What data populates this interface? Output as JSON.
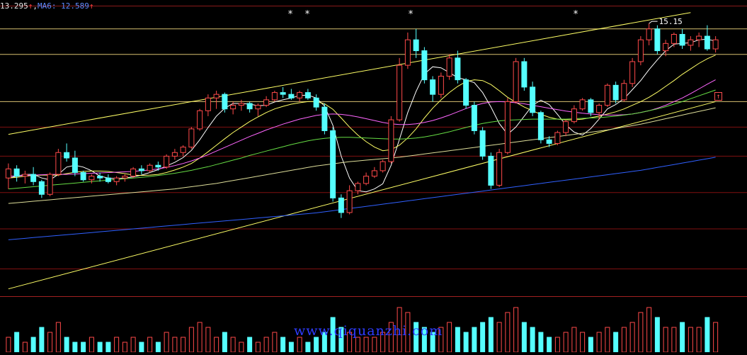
{
  "header": {
    "price_value": "13.295",
    "arrow_up": "↑",
    "separator": ",",
    "ma_label": "MA6: 12.589"
  },
  "annotations": {
    "peak_label": "15.15",
    "markers": [
      "*",
      "*",
      "*",
      "*"
    ],
    "buy_signal": "↑"
  },
  "watermark": "www.qiquanzhi.com",
  "colors": {
    "up": "#ff4a4a",
    "down": "#55ffff",
    "ma_short": "#ffffff",
    "ma_mid": "#ffff66",
    "ma_purple": "#ff66ff",
    "ma_green": "#66dd44",
    "ma_long": "#3060ff",
    "trend": "#ffff66",
    "grid": "#801010"
  },
  "chart_data": {
    "type": "candlestick",
    "title": "",
    "xlabel": "",
    "ylabel": "",
    "ylim": [
      8.0,
      15.6
    ],
    "max_label": 15.15,
    "ohlc": [
      [
        10.9,
        11.3,
        10.6,
        11.15
      ],
      [
        11.15,
        11.25,
        10.8,
        10.95
      ],
      [
        10.95,
        11.1,
        10.75,
        11.0
      ],
      [
        11.0,
        11.2,
        10.7,
        10.8
      ],
      [
        10.8,
        10.85,
        10.35,
        10.45
      ],
      [
        10.45,
        11.05,
        10.4,
        11.0
      ],
      [
        11.0,
        11.7,
        10.95,
        11.6
      ],
      [
        11.6,
        11.85,
        11.35,
        11.45
      ],
      [
        11.45,
        11.65,
        10.95,
        11.05
      ],
      [
        11.05,
        11.1,
        10.8,
        10.85
      ],
      [
        10.85,
        11.0,
        10.75,
        10.95
      ],
      [
        10.95,
        11.05,
        10.8,
        10.9
      ],
      [
        10.9,
        11.0,
        10.75,
        10.8
      ],
      [
        10.8,
        10.95,
        10.7,
        10.9
      ],
      [
        10.9,
        11.0,
        10.8,
        10.95
      ],
      [
        10.95,
        11.2,
        10.9,
        11.15
      ],
      [
        11.15,
        11.25,
        11.0,
        11.1
      ],
      [
        11.1,
        11.3,
        11.05,
        11.25
      ],
      [
        11.25,
        11.35,
        11.1,
        11.2
      ],
      [
        11.2,
        11.55,
        11.15,
        11.5
      ],
      [
        11.5,
        11.7,
        11.4,
        11.6
      ],
      [
        11.6,
        11.8,
        11.5,
        11.75
      ],
      [
        11.75,
        12.3,
        11.7,
        12.25
      ],
      [
        12.25,
        12.8,
        12.2,
        12.75
      ],
      [
        12.75,
        13.2,
        12.6,
        13.1
      ],
      [
        13.1,
        13.3,
        12.8,
        13.2
      ],
      [
        13.2,
        13.25,
        12.7,
        12.8
      ],
      [
        12.8,
        13.0,
        12.65,
        12.9
      ],
      [
        12.9,
        13.05,
        12.75,
        12.95
      ],
      [
        12.95,
        13.0,
        12.7,
        12.8
      ],
      [
        12.8,
        12.95,
        12.6,
        12.9
      ],
      [
        12.9,
        13.15,
        12.85,
        13.05
      ],
      [
        13.05,
        13.3,
        13.0,
        13.25
      ],
      [
        13.25,
        13.4,
        13.1,
        13.2
      ],
      [
        13.2,
        13.35,
        13.05,
        13.1
      ],
      [
        13.1,
        13.3,
        13.0,
        13.25
      ],
      [
        13.25,
        13.35,
        13.05,
        13.1
      ],
      [
        13.1,
        13.2,
        12.75,
        12.85
      ],
      [
        12.85,
        12.95,
        12.1,
        12.2
      ],
      [
        12.2,
        12.3,
        10.25,
        10.35
      ],
      [
        10.35,
        10.45,
        9.8,
        9.95
      ],
      [
        9.95,
        10.7,
        9.9,
        10.55
      ],
      [
        10.55,
        10.8,
        10.45,
        10.75
      ],
      [
        10.75,
        11.05,
        10.7,
        10.95
      ],
      [
        10.95,
        11.2,
        10.9,
        11.1
      ],
      [
        11.1,
        11.4,
        11.05,
        11.35
      ],
      [
        11.35,
        12.6,
        11.3,
        12.5
      ],
      [
        12.5,
        14.2,
        12.45,
        14.0
      ],
      [
        14.0,
        14.9,
        13.9,
        14.7
      ],
      [
        14.7,
        15.0,
        14.2,
        14.4
      ],
      [
        14.4,
        14.5,
        13.5,
        13.6
      ],
      [
        13.6,
        13.7,
        13.0,
        13.2
      ],
      [
        13.2,
        13.8,
        13.1,
        13.7
      ],
      [
        13.7,
        14.3,
        13.6,
        14.2
      ],
      [
        14.2,
        14.4,
        13.5,
        13.6
      ],
      [
        13.6,
        13.65,
        12.8,
        12.9
      ],
      [
        12.9,
        13.0,
        12.1,
        12.2
      ],
      [
        12.2,
        12.3,
        11.4,
        11.5
      ],
      [
        11.5,
        11.6,
        10.6,
        10.7
      ],
      [
        10.7,
        11.7,
        10.65,
        11.6
      ],
      [
        11.6,
        13.1,
        11.55,
        13.0
      ],
      [
        13.0,
        14.2,
        12.95,
        14.1
      ],
      [
        14.1,
        14.2,
        13.3,
        13.4
      ],
      [
        13.4,
        13.55,
        12.6,
        12.7
      ],
      [
        12.7,
        12.75,
        11.85,
        11.95
      ],
      [
        11.95,
        12.05,
        11.75,
        11.85
      ],
      [
        11.85,
        12.2,
        11.8,
        12.15
      ],
      [
        12.15,
        12.5,
        12.05,
        12.45
      ],
      [
        12.45,
        12.9,
        12.4,
        12.8
      ],
      [
        12.8,
        13.1,
        12.75,
        13.05
      ],
      [
        13.05,
        13.1,
        12.6,
        12.7
      ],
      [
        12.7,
        12.95,
        12.5,
        12.9
      ],
      [
        12.9,
        13.5,
        12.85,
        13.45
      ],
      [
        13.45,
        13.55,
        12.95,
        13.05
      ],
      [
        13.05,
        13.6,
        13.0,
        13.5
      ],
      [
        13.5,
        14.2,
        13.4,
        14.1
      ],
      [
        14.1,
        14.8,
        14.0,
        14.7
      ],
      [
        14.7,
        15.15,
        14.55,
        15.0
      ],
      [
        15.0,
        15.1,
        14.3,
        14.4
      ],
      [
        14.4,
        14.7,
        14.25,
        14.6
      ],
      [
        14.6,
        14.9,
        14.5,
        14.85
      ],
      [
        14.85,
        15.0,
        14.45,
        14.55
      ],
      [
        14.55,
        14.8,
        14.4,
        14.7
      ],
      [
        14.7,
        14.9,
        14.5,
        14.8
      ],
      [
        14.8,
        15.1,
        14.4,
        14.45
      ],
      [
        14.45,
        14.8,
        14.35,
        14.7
      ]
    ],
    "moving_averages": [
      {
        "period": 5,
        "color": "#ffffff",
        "values": [
          10.9,
          10.95,
          11.0,
          11.0,
          10.9,
          10.85,
          11.0,
          11.2,
          11.25,
          11.2,
          11.1,
          10.95,
          10.9,
          10.88,
          10.9,
          10.93,
          10.98,
          11.05,
          11.13,
          11.23,
          11.33,
          11.46,
          11.66,
          11.95,
          12.29,
          12.6,
          12.82,
          12.95,
          12.95,
          12.93,
          12.89,
          12.9,
          12.99,
          13.05,
          13.1,
          13.17,
          13.18,
          13.1,
          12.88,
          12.35,
          11.5,
          10.9,
          10.55,
          10.52,
          10.6,
          10.74,
          11.25,
          11.96,
          12.7,
          13.28,
          13.76,
          13.96,
          13.93,
          13.8,
          13.66,
          13.6,
          13.52,
          13.25,
          12.85,
          12.4,
          12.1,
          12.3,
          12.6,
          12.9,
          13.04,
          12.92,
          12.65,
          12.36,
          12.16,
          12.08,
          12.26,
          12.52,
          12.8,
          12.92,
          13.08,
          13.33,
          13.58,
          13.88,
          14.15,
          14.4,
          14.58,
          14.6,
          14.62,
          14.7,
          14.72,
          14.66
        ]
      },
      {
        "period": 10,
        "color": "#ffff66",
        "values": [
          10.9,
          10.92,
          10.95,
          10.97,
          10.98,
          10.98,
          10.98,
          11.02,
          11.06,
          11.08,
          11.09,
          11.09,
          11.08,
          11.05,
          11.02,
          10.98,
          10.97,
          10.98,
          11.0,
          11.05,
          11.12,
          11.2,
          11.3,
          11.45,
          11.62,
          11.8,
          11.98,
          12.15,
          12.3,
          12.45,
          12.58,
          12.7,
          12.8,
          12.87,
          12.93,
          12.97,
          13.0,
          13.0,
          12.94,
          12.79,
          12.55,
          12.3,
          12.08,
          11.9,
          11.75,
          11.65,
          11.68,
          11.8,
          12.0,
          12.25,
          12.55,
          12.82,
          13.05,
          13.25,
          13.42,
          13.55,
          13.6,
          13.58,
          13.47,
          13.3,
          13.12,
          12.98,
          12.85,
          12.75,
          12.65,
          12.57,
          12.52,
          12.5,
          12.5,
          12.52,
          12.56,
          12.6,
          12.66,
          12.72,
          12.8,
          12.9,
          13.0,
          13.12,
          13.26,
          13.42,
          13.58,
          13.75,
          13.9,
          14.05,
          14.18,
          14.28
        ]
      },
      {
        "period": 20,
        "color": "#ff66ff",
        "values": [
          10.95,
          10.96,
          10.97,
          10.98,
          10.99,
          11.0,
          11.0,
          11.0,
          11.01,
          11.02,
          11.03,
          11.04,
          11.05,
          11.06,
          11.07,
          11.08,
          11.1,
          11.12,
          11.15,
          11.19,
          11.24,
          11.3,
          11.37,
          11.45,
          11.54,
          11.64,
          11.74,
          11.84,
          11.94,
          12.04,
          12.13,
          12.22,
          12.3,
          12.38,
          12.45,
          12.52,
          12.57,
          12.62,
          12.65,
          12.66,
          12.65,
          12.62,
          12.58,
          12.53,
          12.48,
          12.43,
          12.39,
          12.37,
          12.37,
          12.39,
          12.43,
          12.48,
          12.55,
          12.63,
          12.72,
          12.81,
          12.89,
          12.95,
          12.99,
          13.0,
          12.99,
          12.97,
          12.94,
          12.9,
          12.86,
          12.82,
          12.78,
          12.74,
          12.71,
          12.68,
          12.66,
          12.64,
          12.63,
          12.63,
          12.64,
          12.66,
          12.7,
          12.75,
          12.82,
          12.9,
          13.0,
          13.1,
          13.22,
          13.35,
          13.48,
          13.6
        ]
      },
      {
        "period": 30,
        "color": "#66dd44",
        "values": [
          10.6,
          10.62,
          10.64,
          10.66,
          10.68,
          10.7,
          10.72,
          10.74,
          10.76,
          10.78,
          10.8,
          10.82,
          10.84,
          10.86,
          10.88,
          10.9,
          10.92,
          10.94,
          10.97,
          11.0,
          11.03,
          11.07,
          11.11,
          11.16,
          11.21,
          11.27,
          11.33,
          11.39,
          11.45,
          11.52,
          11.58,
          11.64,
          11.7,
          11.76,
          11.82,
          11.87,
          11.92,
          11.96,
          11.99,
          12.01,
          12.02,
          12.02,
          12.01,
          12.0,
          11.99,
          11.98,
          11.97,
          11.97,
          11.98,
          12.0,
          12.03,
          12.07,
          12.12,
          12.17,
          12.23,
          12.29,
          12.35,
          12.4,
          12.44,
          12.47,
          12.49,
          12.5,
          12.51,
          12.52,
          12.52,
          12.52,
          12.52,
          12.52,
          12.53,
          12.54,
          12.55,
          12.56,
          12.58,
          12.6,
          12.63,
          12.66,
          12.7,
          12.75,
          12.8,
          12.86,
          12.93,
          13.0,
          13.08,
          13.16,
          13.24,
          13.32
        ]
      },
      {
        "period": 60,
        "color": "#dddd99",
        "values": [
          10.2,
          10.22,
          10.24,
          10.26,
          10.28,
          10.3,
          10.32,
          10.34,
          10.36,
          10.38,
          10.4,
          10.42,
          10.44,
          10.46,
          10.48,
          10.5,
          10.52,
          10.54,
          10.56,
          10.58,
          10.6,
          10.63,
          10.66,
          10.69,
          10.72,
          10.75,
          10.79,
          10.83,
          10.87,
          10.91,
          10.95,
          10.99,
          11.03,
          11.07,
          11.11,
          11.15,
          11.19,
          11.23,
          11.26,
          11.29,
          11.32,
          11.35,
          11.37,
          11.39,
          11.41,
          11.43,
          11.45,
          11.47,
          11.5,
          11.53,
          11.56,
          11.59,
          11.62,
          11.65,
          11.68,
          11.71,
          11.74,
          11.77,
          11.8,
          11.83,
          11.86,
          11.89,
          11.92,
          11.95,
          11.98,
          12.01,
          12.04,
          12.07,
          12.1,
          12.13,
          12.16,
          12.19,
          12.22,
          12.26,
          12.3,
          12.34,
          12.38,
          12.43,
          12.48,
          12.53,
          12.58,
          12.63,
          12.68,
          12.73,
          12.78,
          12.83
        ]
      },
      {
        "period": 120,
        "color": "#3060ff",
        "values": [
          9.2,
          9.22,
          9.24,
          9.26,
          9.28,
          9.3,
          9.32,
          9.34,
          9.36,
          9.38,
          9.4,
          9.42,
          9.44,
          9.46,
          9.48,
          9.5,
          9.52,
          9.54,
          9.56,
          9.58,
          9.6,
          9.62,
          9.64,
          9.66,
          9.68,
          9.7,
          9.72,
          9.74,
          9.76,
          9.78,
          9.8,
          9.82,
          9.84,
          9.86,
          9.88,
          9.9,
          9.92,
          9.94,
          9.97,
          10.0,
          10.03,
          10.06,
          10.09,
          10.12,
          10.15,
          10.18,
          10.21,
          10.24,
          10.27,
          10.3,
          10.33,
          10.36,
          10.39,
          10.42,
          10.45,
          10.48,
          10.51,
          10.54,
          10.57,
          10.6,
          10.63,
          10.66,
          10.69,
          10.72,
          10.75,
          10.78,
          10.81,
          10.84,
          10.87,
          10.9,
          10.93,
          10.96,
          10.99,
          11.02,
          11.05,
          11.08,
          11.11,
          11.15,
          11.19,
          11.23,
          11.27,
          11.31,
          11.35,
          11.39,
          11.43,
          11.47
        ]
      }
    ],
    "horizontal_levels": [
      15.0,
      14.3,
      13.0,
      12.3,
      11.5,
      10.5,
      9.5,
      8.4
    ],
    "trend_channel": {
      "upper": {
        "from": [
          0,
          12.1
        ],
        "to": [
          82,
          15.45
        ]
      },
      "lower": {
        "from": [
          0,
          7.85
        ],
        "to": [
          85,
          13.0
        ]
      }
    },
    "volume": [
      3,
      4,
      2,
      3,
      5,
      4,
      6,
      3,
      2,
      2,
      3,
      2,
      2,
      3,
      2,
      3,
      2,
      3,
      2,
      4,
      3,
      3,
      5,
      6,
      5,
      3,
      4,
      3,
      2,
      3,
      2,
      3,
      4,
      3,
      2,
      3,
      2,
      3,
      4,
      7,
      5,
      4,
      3,
      3,
      3,
      4,
      6,
      9,
      8,
      6,
      5,
      4,
      5,
      6,
      5,
      4,
      5,
      6,
      7,
      6,
      8,
      9,
      6,
      5,
      4,
      3,
      3,
      4,
      5,
      4,
      3,
      4,
      5,
      4,
      5,
      6,
      8,
      9,
      7,
      5,
      5,
      6,
      5,
      5,
      7,
      6
    ]
  }
}
